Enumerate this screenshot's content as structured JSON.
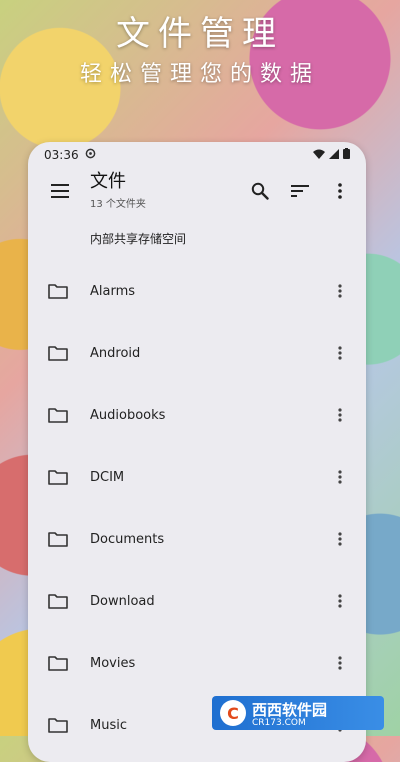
{
  "banner": {
    "title": "文件管理",
    "subtitle": "轻松管理您的数据"
  },
  "status": {
    "time": "03:36",
    "icons": [
      "sync-icon",
      "wifi-icon",
      "signal-icon",
      "battery-icon"
    ]
  },
  "toolbar": {
    "title": "文件",
    "subtitle": "13 个文件夹",
    "icons": [
      "menu-icon",
      "search-icon",
      "sort-icon",
      "more-vert-icon"
    ]
  },
  "breadcrumb": "内部共享存储空间",
  "folders": [
    {
      "name": "Alarms"
    },
    {
      "name": "Android"
    },
    {
      "name": "Audiobooks"
    },
    {
      "name": "DCIM"
    },
    {
      "name": "Documents"
    },
    {
      "name": "Download"
    },
    {
      "name": "Movies"
    },
    {
      "name": "Music"
    }
  ],
  "watermark": {
    "brand": "西西软件园",
    "site": "CR173.COM"
  }
}
